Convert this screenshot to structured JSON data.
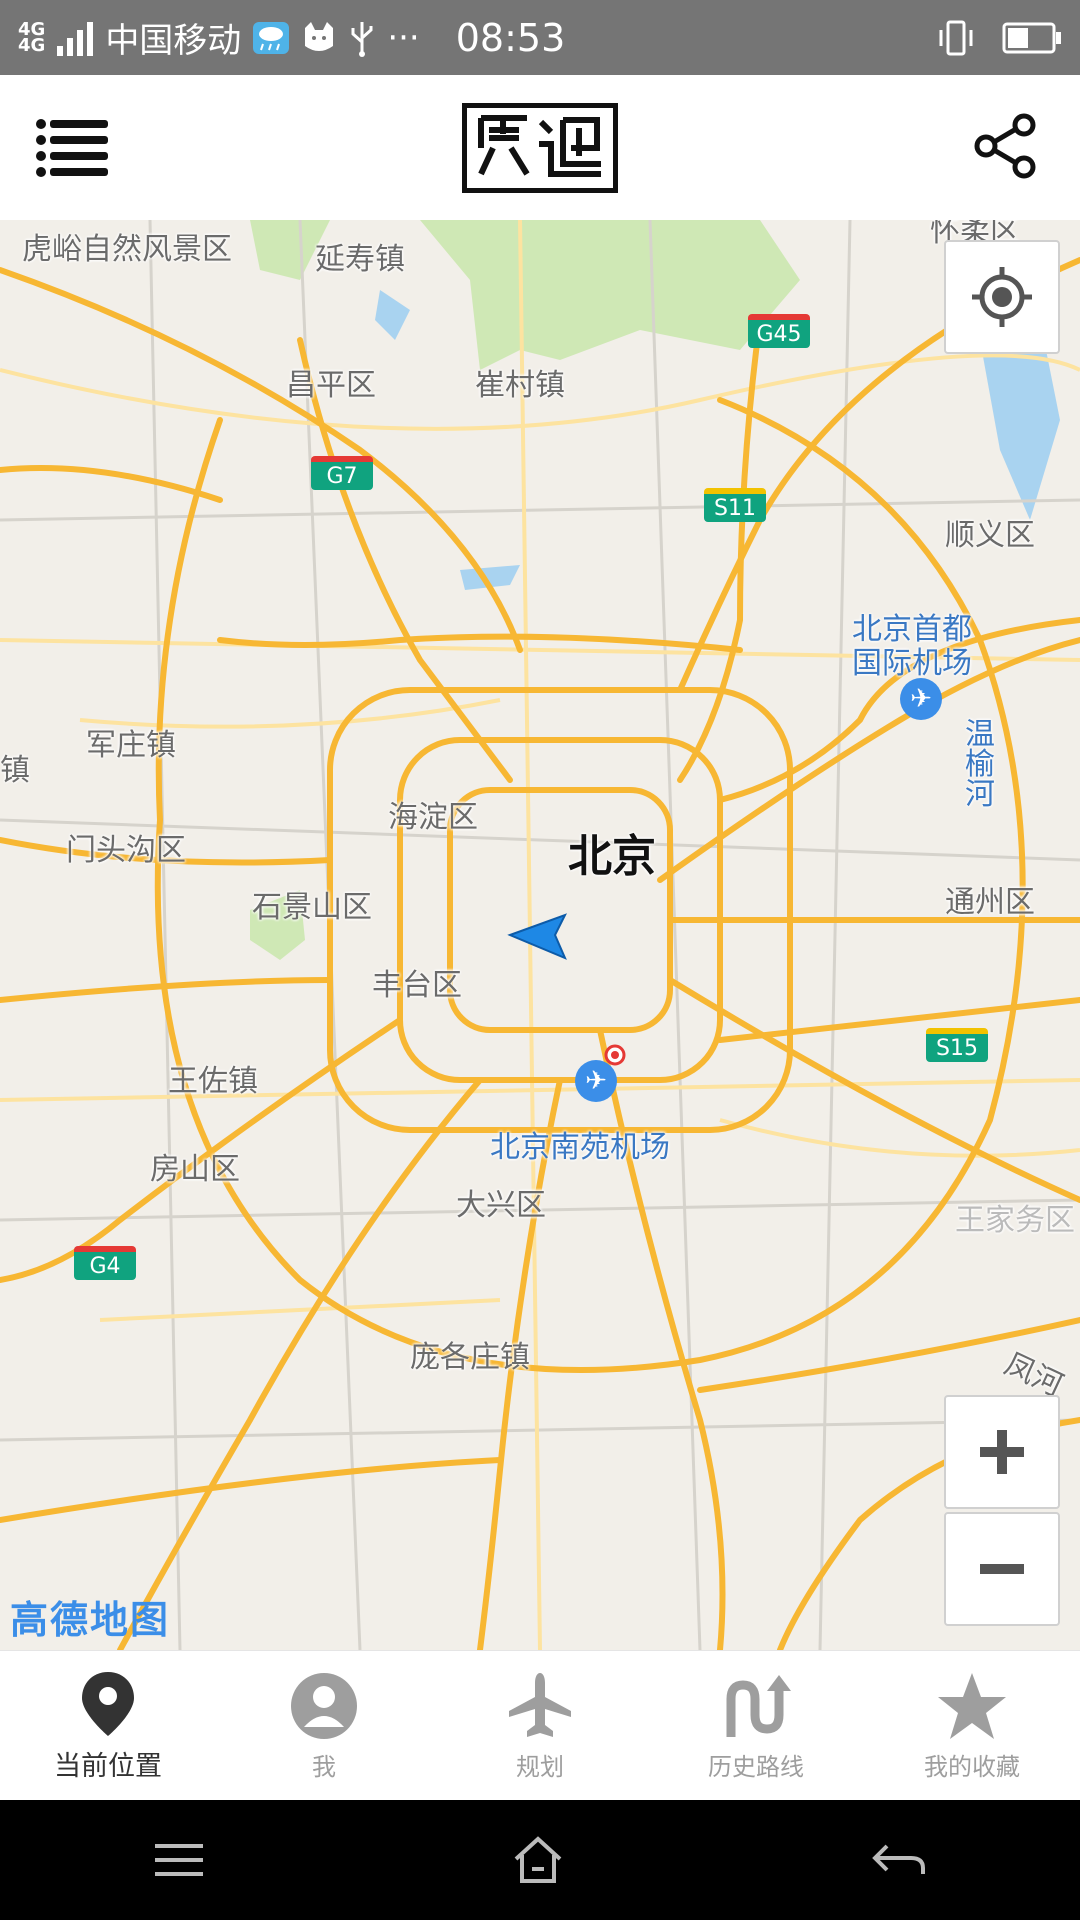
{
  "status_bar": {
    "network1": "4G",
    "network2": "4G",
    "carrier": "中国移动",
    "more": "···",
    "time": "08:53"
  },
  "header": {
    "logo_text": "觅迹"
  },
  "map": {
    "places": {
      "huyu": "虎峪自然风景区",
      "yanshou": "延寿镇",
      "changping": "昌平区",
      "cuicun": "崔村镇",
      "shunyi": "顺义区",
      "capital_airport": "北京首都\n国际机场",
      "junzhuang": "军庄镇",
      "haidian": "海淀区",
      "beijing": "北京",
      "wenyuhe": "温\n榆\n河",
      "mentougou": "门头沟区",
      "shijingshan": "石景山区",
      "tongzhou": "通州区",
      "fengtai": "丰台区",
      "wangzuo": "王佐镇",
      "nanyuan_airport": "北京南苑机场",
      "fangshan": "房山区",
      "daxing": "大兴区",
      "pangezhuang": "庞各庄镇",
      "top_right_partial": "怀柔区",
      "right_partial": "王家务区",
      "left_partial": "镇",
      "fenghe_partial": "凤河"
    },
    "shields": {
      "g45": "G45",
      "g7": "G7",
      "s11": "S11",
      "s15": "S15",
      "g4": "G4"
    },
    "provider": "高德地图"
  },
  "tabs": [
    {
      "label": "当前位置",
      "icon": "location-pin-icon",
      "active": true
    },
    {
      "label": "我",
      "icon": "user-icon",
      "active": false
    },
    {
      "label": "规划",
      "icon": "airplane-icon",
      "active": false
    },
    {
      "label": "历史路线",
      "icon": "route-icon",
      "active": false
    },
    {
      "label": "我的收藏",
      "icon": "star-icon",
      "active": false
    }
  ],
  "colors": {
    "status_bar": "#757575",
    "road": "#f7b733",
    "accent_blue": "#3b8ee8",
    "shield_green": "#10a37f"
  }
}
